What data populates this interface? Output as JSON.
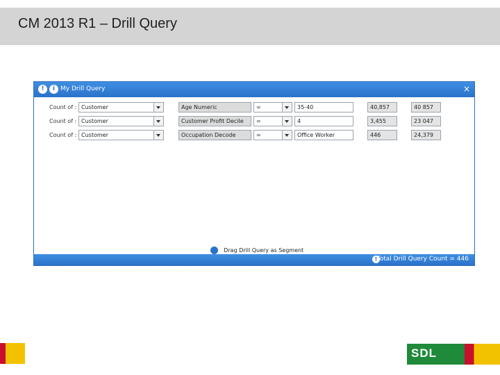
{
  "slide": {
    "title": "CM 2013 R1 – Drill Query"
  },
  "window": {
    "title": "My Drill Query",
    "close_glyph": "×",
    "rows": [
      {
        "label": "Count of :",
        "entity": "Customer",
        "attribute": "Age Numeric",
        "operator": "=",
        "value": "35-40",
        "count": "40,857",
        "total": "40 857"
      },
      {
        "label": "Count of :",
        "entity": "Customer",
        "attribute": "Customer Profit Decile",
        "operator": "=",
        "value": "4",
        "count": "3,455",
        "total": "23 047"
      },
      {
        "label": "Count of :",
        "entity": "Customer",
        "attribute": "Occupation Decode",
        "operator": "=",
        "value": "Office Worker",
        "count": "446",
        "total": "24,379"
      }
    ],
    "drag_label": "Drag Drill Query as Segment",
    "status_total": "Total Drill Query Count = 446"
  },
  "footer": {
    "logo_text": "SDL"
  },
  "colors": {
    "titlebar_blue": "#2a72c9",
    "header_grey": "#d4d4d4",
    "sdl_green": "#1f8a3a",
    "accent_red": "#c8102e",
    "accent_yellow": "#f2c200"
  }
}
